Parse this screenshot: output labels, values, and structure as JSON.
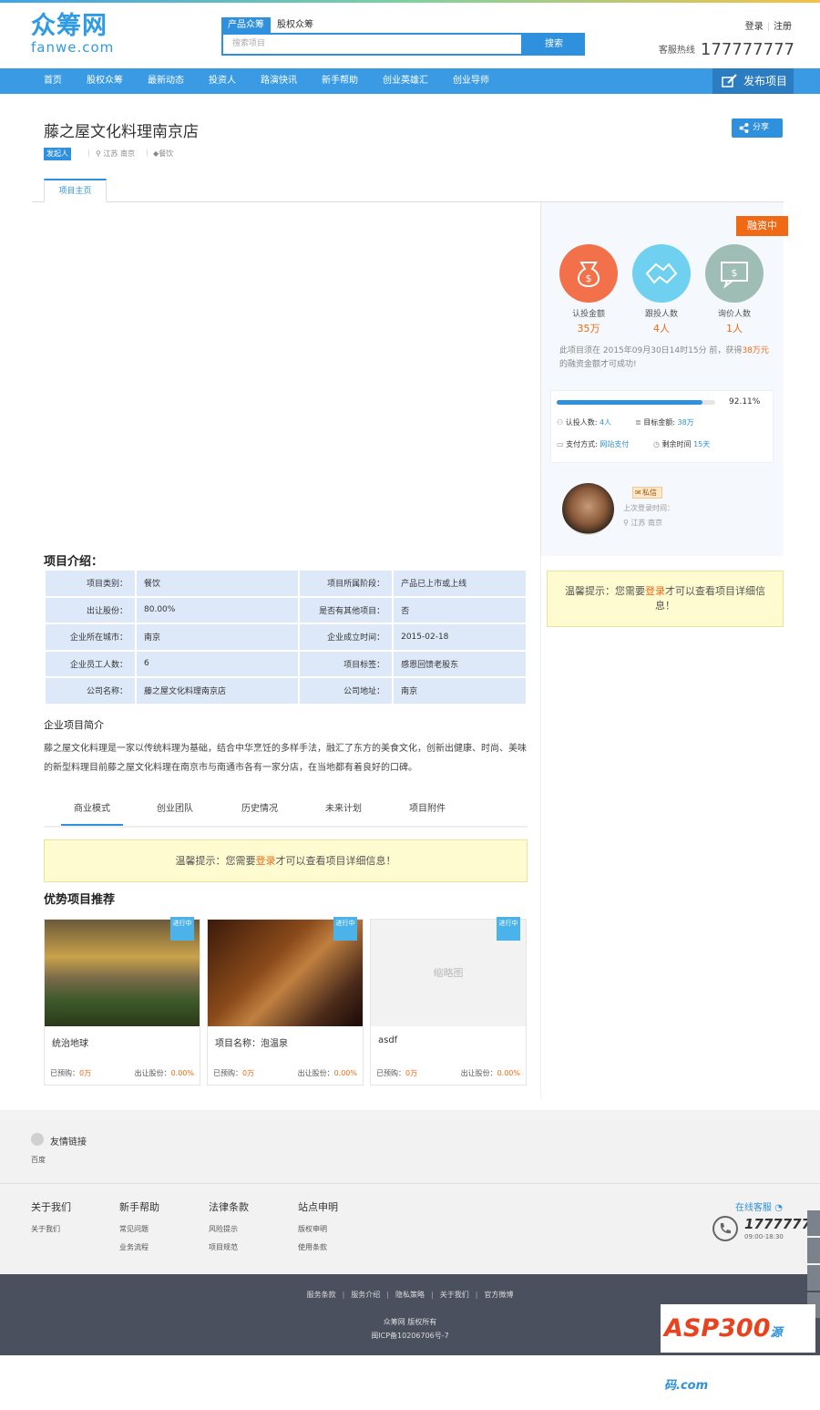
{
  "header": {
    "logo_cn": "众筹网",
    "logo_en": "fanwe.com",
    "search_tabs": [
      "产品众筹",
      "股权众筹"
    ],
    "search_placeholder": "搜索项目",
    "search_button": "搜索",
    "login": "登录",
    "register": "注册",
    "hotline_label": "客服热线",
    "hotline_number": "177777777"
  },
  "nav": {
    "items": [
      "首页",
      "股权众筹",
      "最新动态",
      "投资人",
      "路演快讯",
      "新手帮助",
      "创业英雄汇",
      "创业导师"
    ],
    "publish": "发布项目"
  },
  "project": {
    "title": "藤之屋文化料理南京店",
    "share": "分享",
    "initiator_tag": "发起人",
    "location": "江苏 南京",
    "category_tag": "餐饮",
    "tab_main": "项目主页"
  },
  "side": {
    "status": "融资中",
    "stats": [
      {
        "label": "认投金额",
        "value": "35万",
        "color": "#f2714a",
        "icon": "money-bag-icon"
      },
      {
        "label": "跟投人数",
        "value": "4人",
        "color": "#6fd0f0",
        "icon": "handshake-icon"
      },
      {
        "label": "询价人数",
        "value": "1人",
        "color": "#9ebdb5",
        "icon": "dollar-chat-icon"
      }
    ],
    "notice_pre": "此项目须在 2015年09月30日14时15分 前，获得",
    "notice_amount": "38万元",
    "notice_post": "的融资金额才可成功!",
    "progress_percent": 92.11,
    "progress_text": "92.11%",
    "investors_label": "认投人数:",
    "investors_value": "4人",
    "target_label": "目标金额:",
    "target_value": "38万",
    "pay_label": "支付方式:",
    "pay_value": "网站支付",
    "remain_label": "剩余时间",
    "remain_value": "15天",
    "message_button": "私信",
    "last_login": "上次登录时间：",
    "user_location": "江苏 南京",
    "warn_pre": "温馨提示：您需要",
    "warn_link": "登录",
    "warn_post": "才可以查看项目详细信息！"
  },
  "intro": {
    "title": "项目介绍：",
    "rows": [
      [
        "项目类别：",
        "餐饮",
        "项目所属阶段：",
        "产品已上市或上线"
      ],
      [
        "出让股份：",
        "80.00%",
        "是否有其他项目：",
        "否"
      ],
      [
        "企业所在城市：",
        "南京",
        "企业成立时间：",
        "2015-02-18"
      ],
      [
        "企业员工人数：",
        "6",
        "项目标签：",
        "感恩回馈老股东"
      ],
      [
        "公司名称：",
        "藤之屋文化料理南京店",
        "公司地址：",
        "南京"
      ]
    ],
    "brief_title": "企业项目简介",
    "brief_text": "藤之屋文化料理是一家以传统料理为基础，结合中华烹饪的多样手法，融汇了东方的美食文化，创新出健康、时尚、美味的新型料理目前藤之屋文化料理在南京市与南通市各有一家分店，在当地都有着良好的口碑。",
    "subtabs": [
      "商业模式",
      "创业团队",
      "历史情况",
      "未来计划",
      "项目附件"
    ],
    "warn_pre": "温馨提示：您需要",
    "warn_link": "登录",
    "warn_post": "才可以查看项目详细信息！"
  },
  "recommend": {
    "title": "优势项目推荐",
    "cards": [
      {
        "badge": "进行中",
        "name": "统治地球",
        "pre_label": "已预购：",
        "pre_value": "0万",
        "share_label": "出让股份：",
        "share_value": "0.00%",
        "thumb": ""
      },
      {
        "badge": "进行中",
        "name": "项目名称：泡温泉",
        "pre_label": "已预购：",
        "pre_value": "0万",
        "share_label": "出让股份：",
        "share_value": "0.00%",
        "thumb": ""
      },
      {
        "badge": "进行中",
        "name": "asdf",
        "pre_label": "已预购：",
        "pre_value": "0万",
        "share_label": "出让股份：",
        "share_value": "0.00%",
        "thumb": "缩略图"
      }
    ]
  },
  "footer": {
    "friend_links": "友情链接",
    "baidu": "百度",
    "cols": [
      {
        "title": "关于我们",
        "items": [
          "关于我们"
        ]
      },
      {
        "title": "新手帮助",
        "items": [
          "常见问题",
          "业务流程"
        ]
      },
      {
        "title": "法律条款",
        "items": [
          "风险提示",
          "项目规范"
        ]
      },
      {
        "title": "站点申明",
        "items": [
          "版权申明",
          "使用条款"
        ]
      }
    ],
    "online_service": "在线客服",
    "service_number": "17777777",
    "service_time": "09:00-18:30",
    "bottom_links": [
      "服务条款",
      "服务介绍",
      "隐私策略",
      "关于我们",
      "官方微博"
    ],
    "copyright": "众筹网 版权所有",
    "icp": "闽ICP备10206706号-7",
    "watermark_main": "ASP300",
    "watermark_sub": "源码",
    "watermark_domain": ".com"
  }
}
